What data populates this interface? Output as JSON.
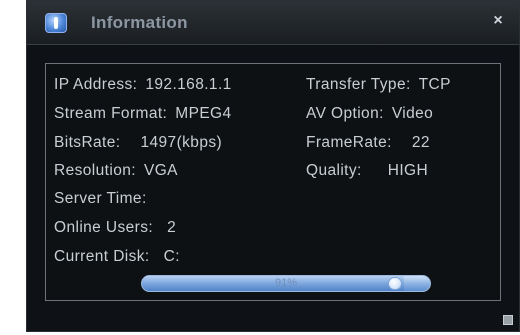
{
  "window": {
    "title": "Information",
    "title_icon": "info-icon",
    "close_glyph": "×"
  },
  "info": {
    "ip_address": {
      "label": "IP Address:",
      "value": "192.168.1.1"
    },
    "transfer_type": {
      "label": "Transfer Type:",
      "value": "TCP"
    },
    "stream_format": {
      "label": "Stream Format:",
      "value": "MPEG4"
    },
    "av_option": {
      "label": "AV Option:",
      "value": "Video"
    },
    "bitsrate": {
      "label": "BitsRate:",
      "value": "1497(kbps)"
    },
    "framerate": {
      "label": "FrameRate:",
      "value": "22"
    },
    "resolution": {
      "label": "Resolution:",
      "value": "VGA"
    },
    "quality": {
      "label": "Quality:",
      "value": "HIGH"
    },
    "server_time": {
      "label": "Server Time:",
      "value": ""
    },
    "online_users": {
      "label": "Online Users:",
      "value": "2"
    },
    "current_disk": {
      "label": "Current Disk:",
      "value": "C:"
    }
  },
  "disk_usage": {
    "percent": 91,
    "label": "91%"
  },
  "colors": {
    "background": "#0e1216",
    "text": "#c9ced2",
    "title_text": "#8c97a2",
    "progress": "#7da6dd"
  }
}
